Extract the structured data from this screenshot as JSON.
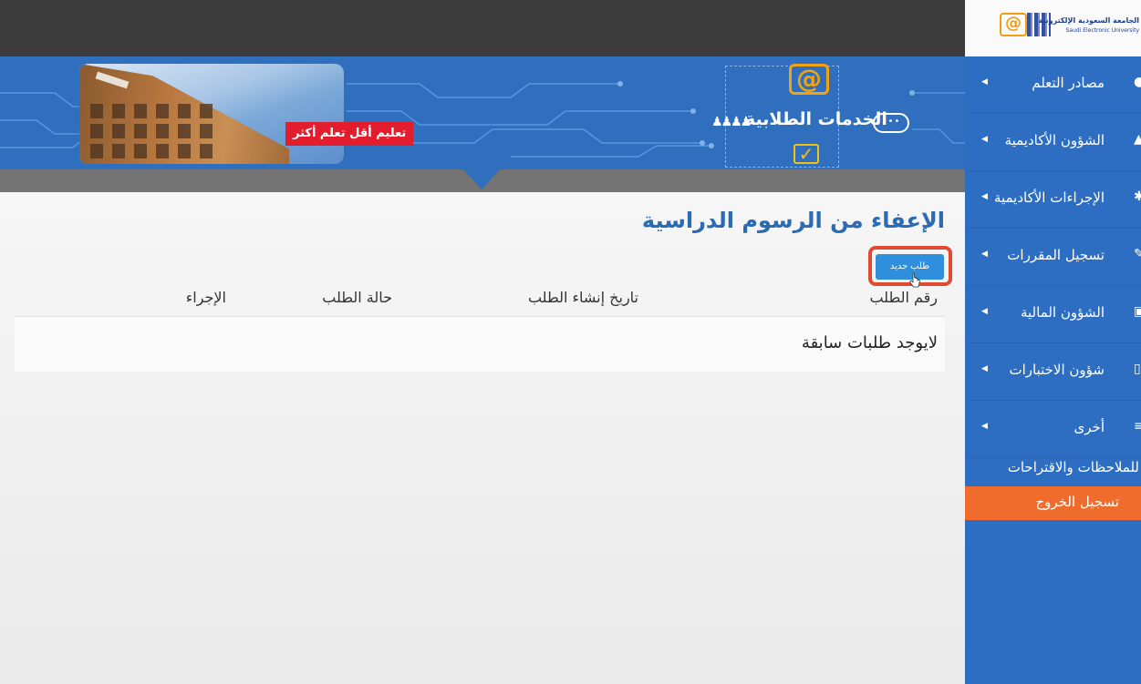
{
  "brand": {
    "name_ar": "الجامعة السعودية الإلكترونية",
    "name_en": "Saudi Electronic University"
  },
  "banner": {
    "slogan": "تعليم أقل تعلم أكثر",
    "services_title": "الخدمات الطلابية"
  },
  "page": {
    "title": "الإعفاء من الرسوم الدراسية",
    "new_request_button": "طلب جديد",
    "columns": {
      "request_number": "رقم الطلب",
      "created_date": "تاريخ إنشاء الطلب",
      "status": "حالة الطلب",
      "action": "الإجراء"
    },
    "empty_message": "لايوجد طلبات سابقة"
  },
  "sidebar": {
    "items": [
      {
        "label": "مصادر التعلم",
        "icon": "globe-icon"
      },
      {
        "label": "الشؤون الأكاديمية",
        "icon": "graduation-cap-icon"
      },
      {
        "label": "الإجراءات الأكاديمية",
        "icon": "gear-icon"
      },
      {
        "label": "تسجيل المقررات",
        "icon": "pencil-icon"
      },
      {
        "label": "الشؤون المالية",
        "icon": "money-icon"
      },
      {
        "label": "شؤون الاختبارات",
        "icon": "document-icon"
      },
      {
        "label": "أخرى",
        "icon": "list-icon"
      }
    ],
    "feedback": "للملاحظات والاقتراحات",
    "logout": "تسجيل الخروج"
  },
  "colors": {
    "primary_blue": "#2f6fbd",
    "sidebar_blue": "#2d6ec3",
    "logout_orange": "#f06c2c",
    "button_blue": "#2f8fdc",
    "highlight_red": "#e04a32",
    "slogan_red": "#e21d2d"
  }
}
